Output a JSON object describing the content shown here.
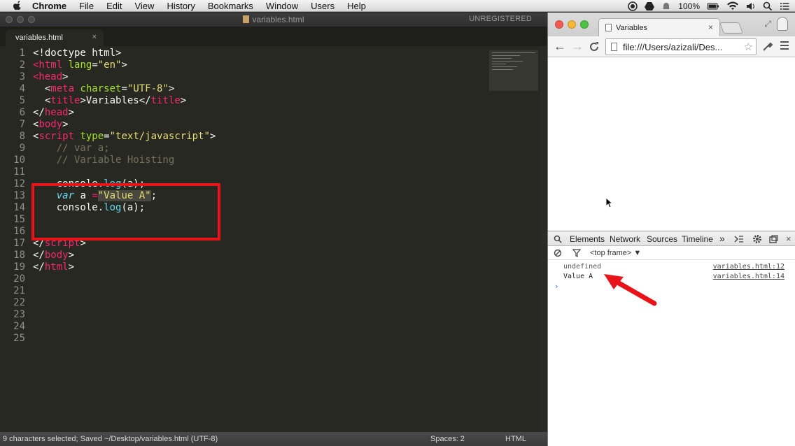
{
  "menubar": {
    "app": "Chrome",
    "items": [
      "File",
      "Edit",
      "View",
      "History",
      "Bookmarks",
      "Window",
      "Users",
      "Help"
    ],
    "battery": "100%"
  },
  "sublime": {
    "title": "variables.html",
    "unregistered": "UNREGISTERED",
    "tab": "variables.html",
    "tab_close": "×",
    "line_numbers": [
      "1",
      "2",
      "3",
      "4",
      "5",
      "6",
      "7",
      "8",
      "9",
      "10",
      "11",
      "12",
      "13",
      "14",
      "15",
      "16",
      "17",
      "18",
      "19",
      "20",
      "21",
      "22",
      "23",
      "24",
      "25"
    ],
    "status_left": "9 characters selected; Saved ~/Desktop/variables.html (UTF-8)",
    "status_spaces": "Spaces: 2",
    "status_syntax": "HTML"
  },
  "chrome": {
    "tab_title": "Variables",
    "tab_close": "×",
    "url": "file:///Users/azizali/Des...",
    "devtools_tabs": [
      "Elements",
      "Network",
      "Sources",
      "Timeline"
    ],
    "more": "»",
    "frame": "<top frame> ▼",
    "console": [
      {
        "message": "undefined",
        "source": "variables.html:12"
      },
      {
        "message": "Value A",
        "source": "variables.html:14"
      }
    ],
    "prompt": "›"
  },
  "colors": {
    "highlight_box": "#e8141a",
    "arrow": "#e8141a"
  }
}
